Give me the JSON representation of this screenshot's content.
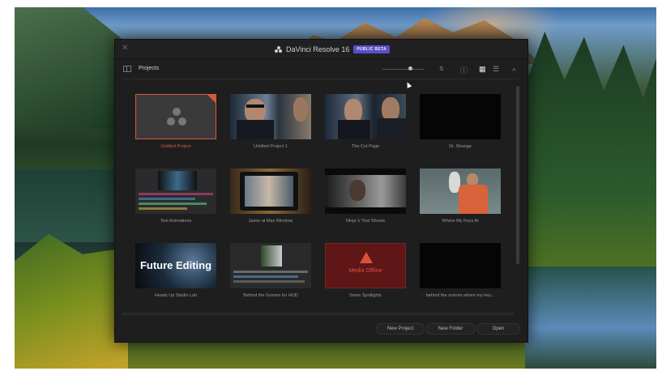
{
  "window": {
    "app_title": "DaVinci Resolve 16",
    "beta_badge": "PUBLIC BETA",
    "close_icon": "close-icon"
  },
  "toolbar": {
    "section_label": "Projects",
    "icons": [
      "sidebar-toggle-icon",
      "zoom-slider",
      "sort-icon",
      "info-icon",
      "grid-view-icon",
      "list-view-icon",
      "search-icon"
    ]
  },
  "projects": [
    {
      "title": "Untitled Project",
      "thumb": "resolve-logo",
      "selected": true
    },
    {
      "title": "Untitled Project 1",
      "thumb": "two-men-car"
    },
    {
      "title": "The Cut Page",
      "thumb": "two-men-car-2"
    },
    {
      "title": "Dr. Strange",
      "thumb": "black"
    },
    {
      "title": "Text Animations",
      "thumb": "resolve-ui"
    },
    {
      "title": "Jason at Max Winslow",
      "thumb": "monitor-rig"
    },
    {
      "title": "Ninja V Test Shoots",
      "thumb": "car-interior"
    },
    {
      "title": "Where My Keys At",
      "thumb": "man-orange-jacket"
    },
    {
      "title": "Heads Up Studio Lab",
      "thumb": "future-editing",
      "thumb_text": "Future Editing"
    },
    {
      "title": "Behind the Scenes for HUD",
      "thumb": "resolve-ui-2"
    },
    {
      "title": "Sams Spotlights",
      "thumb": "media-offline",
      "thumb_text": "Media Offline"
    },
    {
      "title": "behind the scenes where my key...",
      "thumb": "black"
    }
  ],
  "footer": {
    "new_project": "New Project",
    "new_folder": "New Folder",
    "open": "Open"
  },
  "colors": {
    "accent_selected": "#d35a3a",
    "beta_badge": "#5b4fc4",
    "media_offline_bg": "#6e1a1a"
  }
}
